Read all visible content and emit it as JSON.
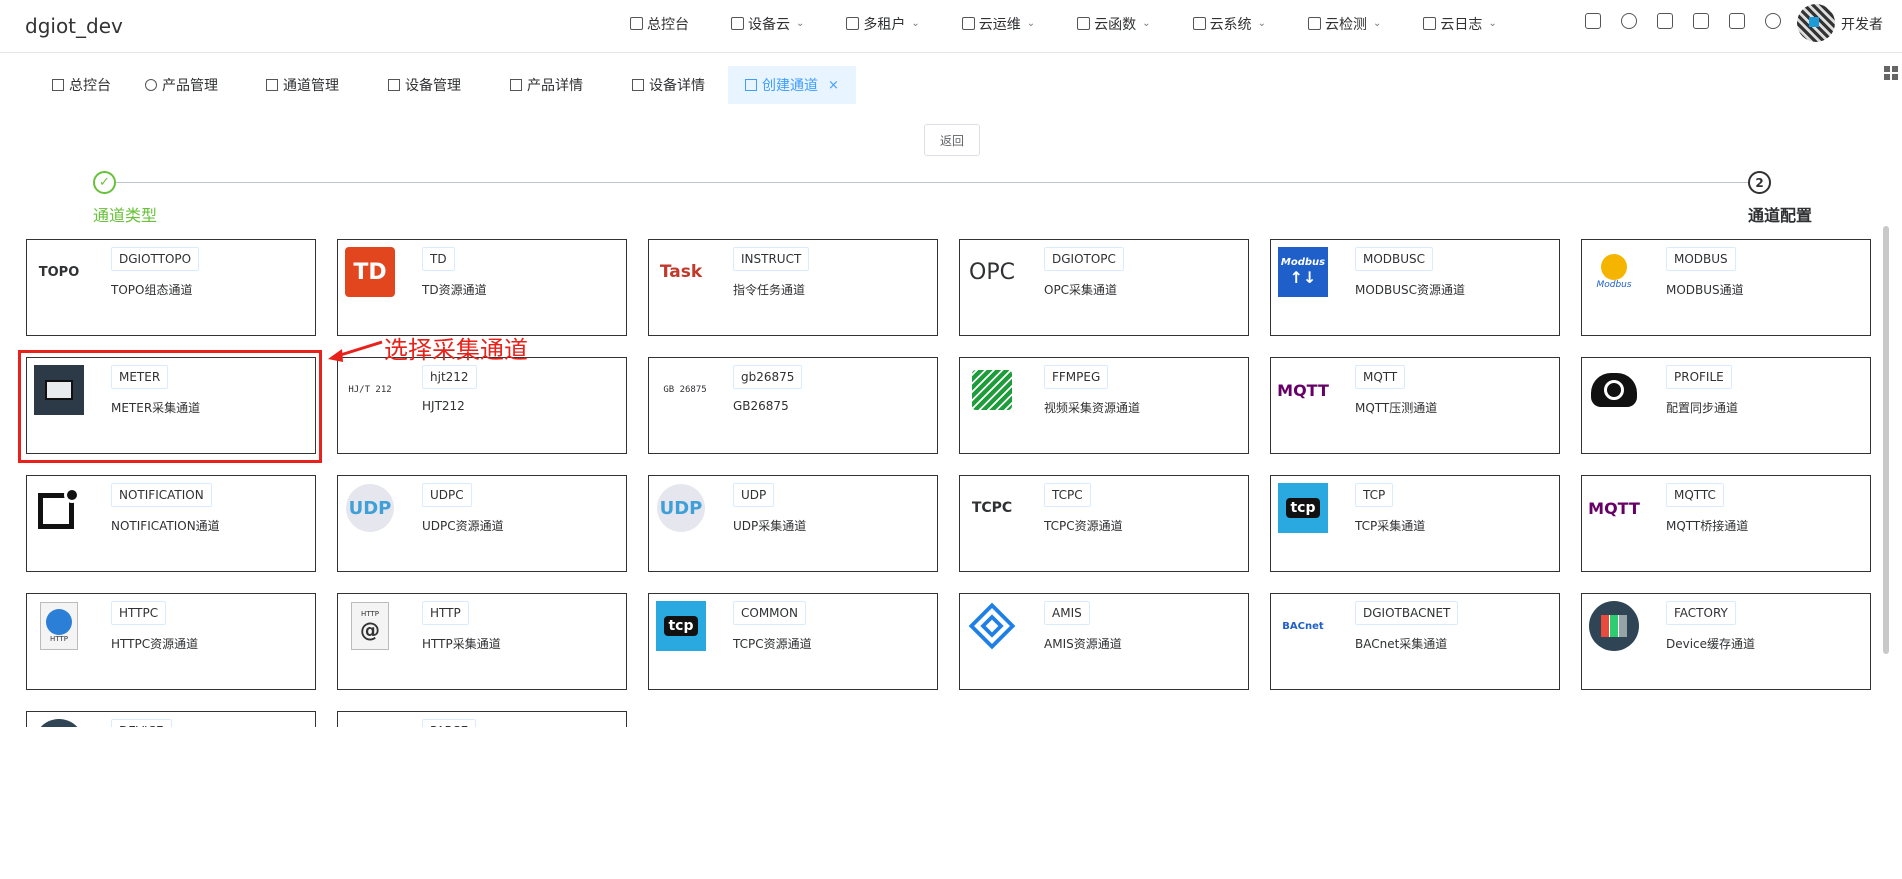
{
  "app": {
    "title": "dgiot_dev"
  },
  "top_nav": [
    {
      "label": "总控台",
      "dropdown": false
    },
    {
      "label": "设备云",
      "dropdown": true
    },
    {
      "label": "多租户",
      "dropdown": true
    },
    {
      "label": "云运维",
      "dropdown": true
    },
    {
      "label": "云函数",
      "dropdown": true
    },
    {
      "label": "云系统",
      "dropdown": true
    },
    {
      "label": "云检测",
      "dropdown": true
    },
    {
      "label": "云日志",
      "dropdown": true
    }
  ],
  "top_tools": [
    "network-icon",
    "bell-icon",
    "document-icon",
    "fullscreen-icon",
    "translate-icon",
    "refresh-icon"
  ],
  "user": {
    "name": "开发者"
  },
  "tabs": [
    {
      "label": "总控台",
      "active": false
    },
    {
      "label": "产品管理",
      "active": false
    },
    {
      "label": "通道管理",
      "active": false
    },
    {
      "label": "设备管理",
      "active": false
    },
    {
      "label": "产品详情",
      "active": false
    },
    {
      "label": "设备详情",
      "active": false
    },
    {
      "label": "创建通道",
      "active": true,
      "close": "×"
    }
  ],
  "back_button": "返回",
  "steps": [
    {
      "num": "✓",
      "title": "通道类型",
      "status": "success"
    },
    {
      "num": "2",
      "title": "通道配置",
      "status": "process"
    }
  ],
  "annotation": {
    "text": "选择采集通道"
  },
  "channels": [
    {
      "tag": "DGIOTTOPO",
      "desc": "TOPO组态通道",
      "logo": "TOPO"
    },
    {
      "tag": "TD",
      "desc": "TD资源通道",
      "logo": "TD"
    },
    {
      "tag": "INSTRUCT",
      "desc": "指令任务通道",
      "logo": "Task"
    },
    {
      "tag": "DGIOTOPC",
      "desc": "OPC采集通道",
      "logo": "OPC"
    },
    {
      "tag": "MODBUSC",
      "desc": "MODBUSC资源通道",
      "logo": "Modbus"
    },
    {
      "tag": "MODBUS",
      "desc": "MODBUS通道",
      "logo": "Modbus"
    },
    {
      "tag": "METER",
      "desc": "METER采集通道",
      "logo": ""
    },
    {
      "tag": "hjt212",
      "desc": "HJT212",
      "logo": "HJ/T 212"
    },
    {
      "tag": "gb26875",
      "desc": "GB26875",
      "logo": "GB 26875"
    },
    {
      "tag": "FFMPEG",
      "desc": "视频采集资源通道",
      "logo": ""
    },
    {
      "tag": "MQTT",
      "desc": "MQTT压测通道",
      "logo": "MQTT"
    },
    {
      "tag": "PROFILE",
      "desc": "配置同步通道",
      "logo": ""
    },
    {
      "tag": "NOTIFICATION",
      "desc": "NOTIFICATION通道",
      "logo": ""
    },
    {
      "tag": "UDPC",
      "desc": "UDPC资源通道",
      "logo": "UDP"
    },
    {
      "tag": "UDP",
      "desc": "UDP采集通道",
      "logo": "UDP"
    },
    {
      "tag": "TCPC",
      "desc": "TCPC资源通道",
      "logo": "TCPC"
    },
    {
      "tag": "TCP",
      "desc": "TCP采集通道",
      "logo": "tcp"
    },
    {
      "tag": "MQTTC",
      "desc": "MQTT桥接通道",
      "logo": "MQTT"
    },
    {
      "tag": "HTTPC",
      "desc": "HTTPC资源通道",
      "logo": "HTTP"
    },
    {
      "tag": "HTTP",
      "desc": "HTTP采集通道",
      "logo": "HTTP"
    },
    {
      "tag": "COMMON",
      "desc": "TCPC资源通道",
      "logo": "tcp"
    },
    {
      "tag": "AMIS",
      "desc": "AMIS资源通道",
      "logo": ""
    },
    {
      "tag": "DGIOTBACNET",
      "desc": "BACnet采集通道",
      "logo": "BACnet"
    },
    {
      "tag": "FACTORY",
      "desc": "Device缓存通道",
      "logo": ""
    },
    {
      "tag": "DEVICE",
      "desc": "",
      "logo": ""
    },
    {
      "tag": "PARSE",
      "desc": "",
      "logo": ""
    }
  ]
}
